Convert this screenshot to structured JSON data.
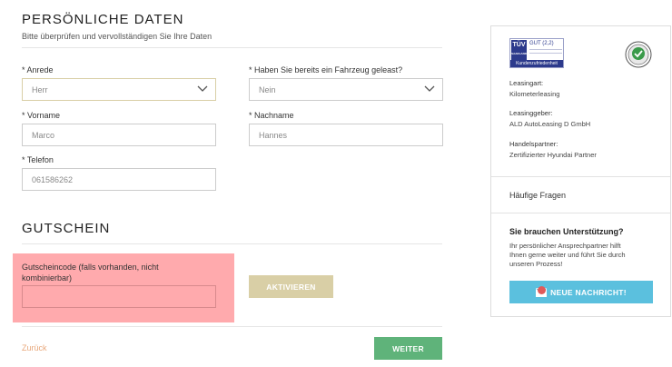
{
  "personal": {
    "title": "PERSÖNLICHE DATEN",
    "subtitle": "Bitte überprüfen und vervollständigen Sie Ihre Daten",
    "anrede": {
      "label": "* Anrede",
      "value": "Herr"
    },
    "geleast": {
      "label": "* Haben Sie bereits ein Fahrzeug geleast?",
      "value": "Nein"
    },
    "vorname": {
      "label": "* Vorname",
      "value": "Marco"
    },
    "nachname": {
      "label": "* Nachname",
      "value": "Hannes"
    },
    "telefon": {
      "label": "* Telefon",
      "value": "061586262"
    }
  },
  "voucher": {
    "title": "GUTSCHEIN",
    "code_label_line1": "Gutscheincode (falls vorhanden, nicht",
    "code_label_line2": "kombinierbar)",
    "code_value": "",
    "activate_label": "AKTIVIEREN"
  },
  "nav": {
    "back_label": "Zurück",
    "next_label": "WEITER"
  },
  "sidebar": {
    "tuv": {
      "brand": "TÜV",
      "brand_sub": "SAARLAND",
      "grade": "GUT (2,2)",
      "caption": "Kundenzufriedenheit"
    },
    "leasingart_label": "Leasingart:",
    "leasingart_value": "Kilometerleasing",
    "leasinggeber_label": "Leasinggeber:",
    "leasinggeber_value": "ALD AutoLeasing D GmbH",
    "handelspartner_label": "Handelspartner:",
    "handelspartner_value": "Zertifizierter Hyundai Partner",
    "faq_label": "Häufige Fragen",
    "support_title": "Sie brauchen Unterstützung?",
    "support_line1": "Ihr persönlicher Ansprechpartner hilft",
    "support_line2": "Ihnen gerne weiter und führt Sie durch",
    "support_line3": "unseren Prozess!",
    "message_button_label": "NEUE NACHRICHT!"
  },
  "colors": {
    "accent_gold": "#d9cfa6",
    "next_green": "#5fb37a",
    "message_blue": "#5bc0de",
    "highlight_red": "#ffaaad",
    "back_orange": "#e8a87c"
  }
}
